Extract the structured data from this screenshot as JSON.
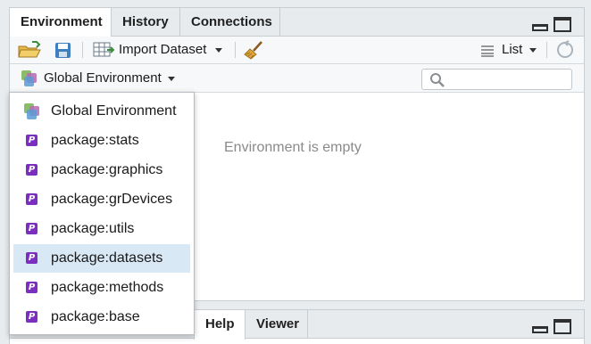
{
  "top_pane": {
    "tabs": [
      {
        "label": "Environment"
      },
      {
        "label": "History"
      },
      {
        "label": "Connections"
      }
    ],
    "toolbar": {
      "import_label": "Import Dataset",
      "view_label": "List"
    },
    "env_selector_label": "Global Environment",
    "search_placeholder": "",
    "empty_message": "Environment is empty"
  },
  "dropdown": {
    "items": [
      {
        "label": "Global Environment",
        "icon": "environment-icon"
      },
      {
        "label": "package:stats",
        "icon": "package-icon"
      },
      {
        "label": "package:graphics",
        "icon": "package-icon"
      },
      {
        "label": "package:grDevices",
        "icon": "package-icon"
      },
      {
        "label": "package:utils",
        "icon": "package-icon"
      },
      {
        "label": "package:datasets",
        "icon": "package-icon",
        "selected": true
      },
      {
        "label": "package:methods",
        "icon": "package-icon"
      },
      {
        "label": "package:base",
        "icon": "package-icon"
      }
    ]
  },
  "bottom_pane": {
    "tabs": [
      {
        "label": "Help"
      },
      {
        "label": "Viewer"
      }
    ]
  },
  "colors": {
    "accent_selected": "#d9e8f5",
    "package_icon": "#7b2fbf",
    "save_icon": "#3f7fbf",
    "folder_icon": "#e8b84a",
    "broom_icon": "#c98a2a"
  }
}
